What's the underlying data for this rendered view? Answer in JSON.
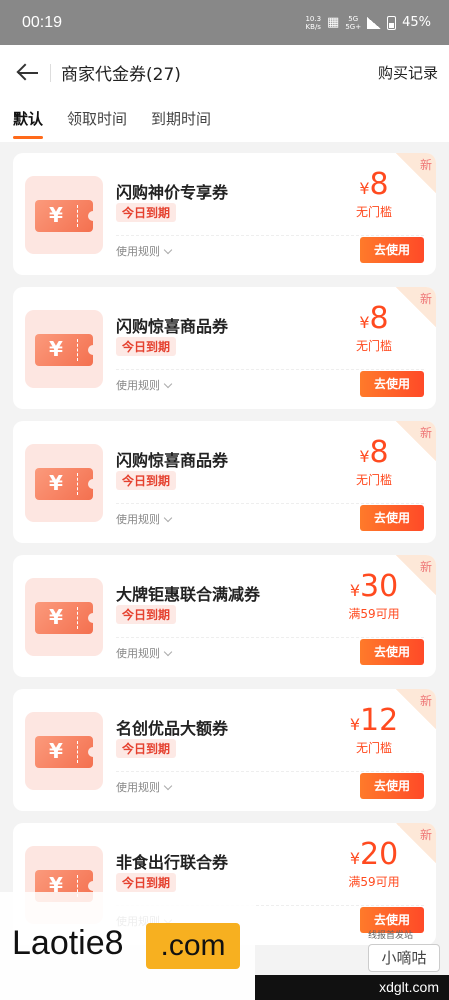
{
  "status": {
    "time": "00:19",
    "net_top": "10.3",
    "net_bottom": "KB/s",
    "sig_top": "5G",
    "sig_bottom": "5G+",
    "battery": "45%"
  },
  "header": {
    "title": "商家代金券(27)",
    "records": "购买记录"
  },
  "tabs": [
    {
      "label": "默认"
    },
    {
      "label": "领取时间"
    },
    {
      "label": "到期时间"
    }
  ],
  "coupon_common": {
    "yen": "¥",
    "expire": "今日到期",
    "rules": "使用规则",
    "use": "去使用",
    "new": "新"
  },
  "coupons": [
    {
      "name": "闪购神价专享券",
      "value": "8",
      "cond": "无门槛"
    },
    {
      "name": "闪购惊喜商品券",
      "value": "8",
      "cond": "无门槛"
    },
    {
      "name": "闪购惊喜商品券",
      "value": "8",
      "cond": "无门槛"
    },
    {
      "name": "大牌钜惠联合满减券",
      "value": "30",
      "cond": "满59可用"
    },
    {
      "name": "名创优品大额券",
      "value": "12",
      "cond": "无门槛"
    },
    {
      "name": "非食出行联合券",
      "value": "20",
      "cond": "满59可用"
    }
  ],
  "watermark": {
    "brand": "Laotie8",
    "dotcom": ".com",
    "note": "线报首发站",
    "small": "小嘀咕",
    "site": "xdglt.com"
  },
  "colors": {
    "accent": "#ff4a1f",
    "button": "#ff5a26",
    "status_bar": "#888888"
  },
  "icons": {
    "back": "back-arrow-icon",
    "coupon": "coupon-ticket-icon",
    "rules": "chevron-down-icon"
  }
}
